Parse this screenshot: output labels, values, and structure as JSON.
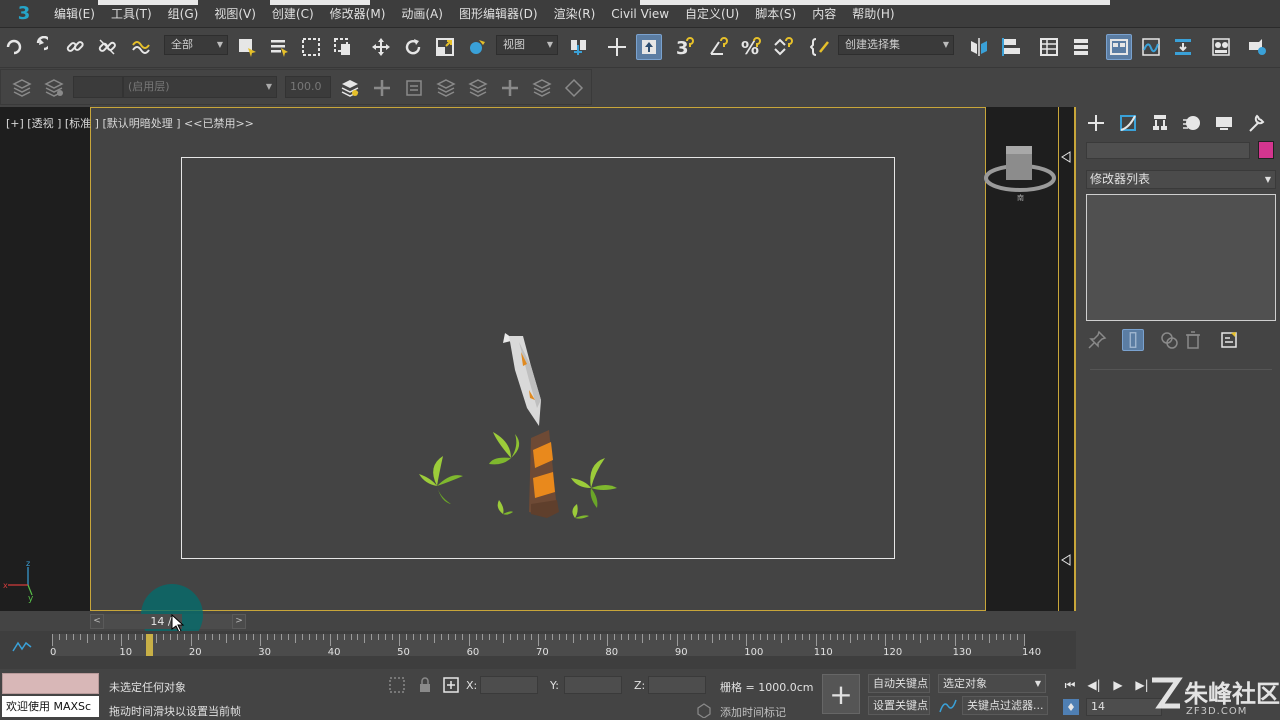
{
  "menubar": {
    "logo": "3",
    "items": [
      "编辑(E)",
      "工具(T)",
      "组(G)",
      "视图(V)",
      "创建(C)",
      "修改器(M)",
      "动画(A)",
      "图形编辑器(D)",
      "渲染(R)",
      "Civil View",
      "自定义(U)",
      "脚本(S)",
      "内容",
      "帮助(H)"
    ]
  },
  "toolbar": {
    "selection_filter": "全部",
    "ref_coord": "视图",
    "named_selection": "创建选择集",
    "snap_label": "3"
  },
  "layer_toolbar": {
    "layer_name": "(启用层)",
    "layer_value": "100.0"
  },
  "viewport": {
    "label": "[+] [透视 ] [标准 ] [默认明暗处理 ]  <<已禁用>>",
    "axis_z": "z",
    "axis_y": "y",
    "axis_x": "x"
  },
  "command_panel": {
    "modifier_list": "修改器列表",
    "object_color": "#d4358f"
  },
  "time_slider": {
    "position": "14 / 140",
    "prev": "<",
    "next": ">",
    "current_frame": 14,
    "total_frames": 140
  },
  "trackbar": {
    "tick_labels": [
      "0",
      "10",
      "20",
      "30",
      "40",
      "50",
      "60",
      "70",
      "80",
      "90",
      "100",
      "110",
      "120",
      "130",
      "140"
    ]
  },
  "status": {
    "maxscript": "欢迎使用 MAXSc",
    "selection_status": "未选定任何对象",
    "prompt": "拖动时间滑块以设置当前帧",
    "x_label": "X:",
    "y_label": "Y:",
    "z_label": "Z:",
    "grid": "栅格 = 1000.0cm",
    "add_time_tag": "添加时间标记",
    "auto_key": "自动关键点",
    "set_key": "设置关键点",
    "selected_object": "选定对象",
    "key_filters": "关键点过滤器...",
    "frame": "14"
  },
  "watermark": {
    "text": "朱峰社区",
    "sub": "ZF3D.COM"
  }
}
